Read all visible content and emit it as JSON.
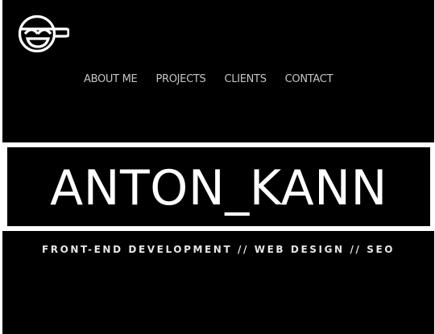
{
  "logo": {
    "icon": "laughing-face-with-cap-logo",
    "color": "#ffffff"
  },
  "nav": {
    "items": [
      {
        "label": "ABOUT ME"
      },
      {
        "label": "PROJECTS"
      },
      {
        "label": "CLIENTS"
      },
      {
        "label": "CONTACT"
      }
    ]
  },
  "hero": {
    "title": "ANTON_KANN",
    "tagline": "FRONT-END DEVELOPMENT // WEB DESIGN // SEO"
  },
  "colors": {
    "background": "#000000",
    "text": "#ffffff",
    "nav_text": "#c4c4c4",
    "banner_border": "#ffffff"
  }
}
